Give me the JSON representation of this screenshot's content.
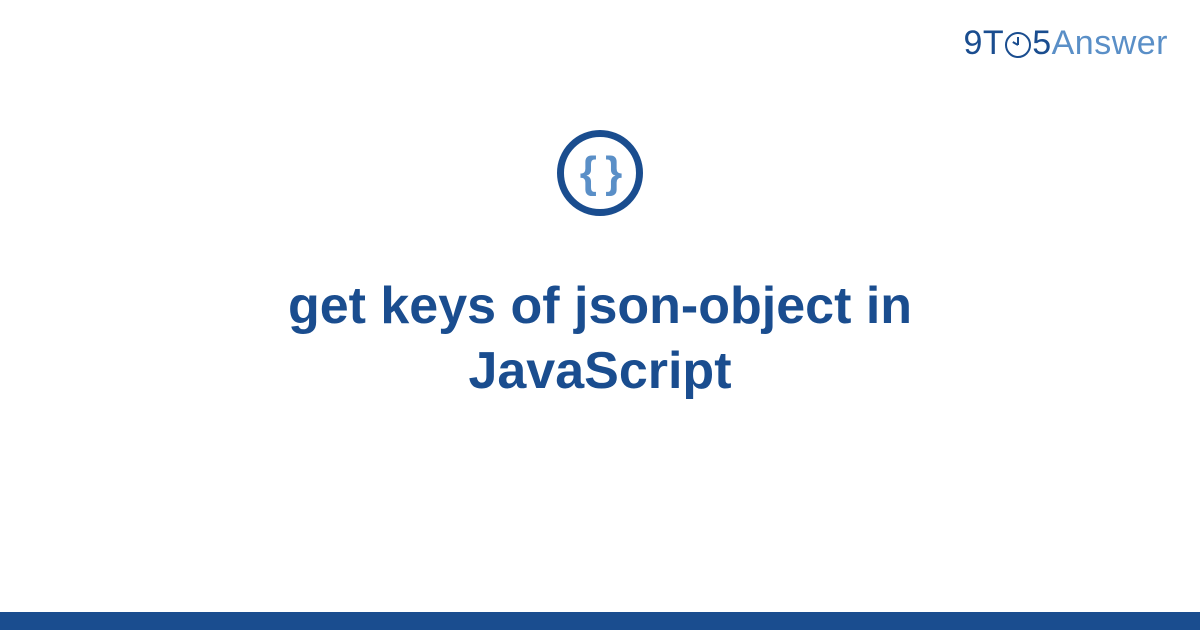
{
  "brand": {
    "part1": "9",
    "part2": "T",
    "part3": "5",
    "part4": "Answer"
  },
  "icon": {
    "glyph": "{ }",
    "name": "braces-icon"
  },
  "title": "get keys of json-object in JavaScript"
}
